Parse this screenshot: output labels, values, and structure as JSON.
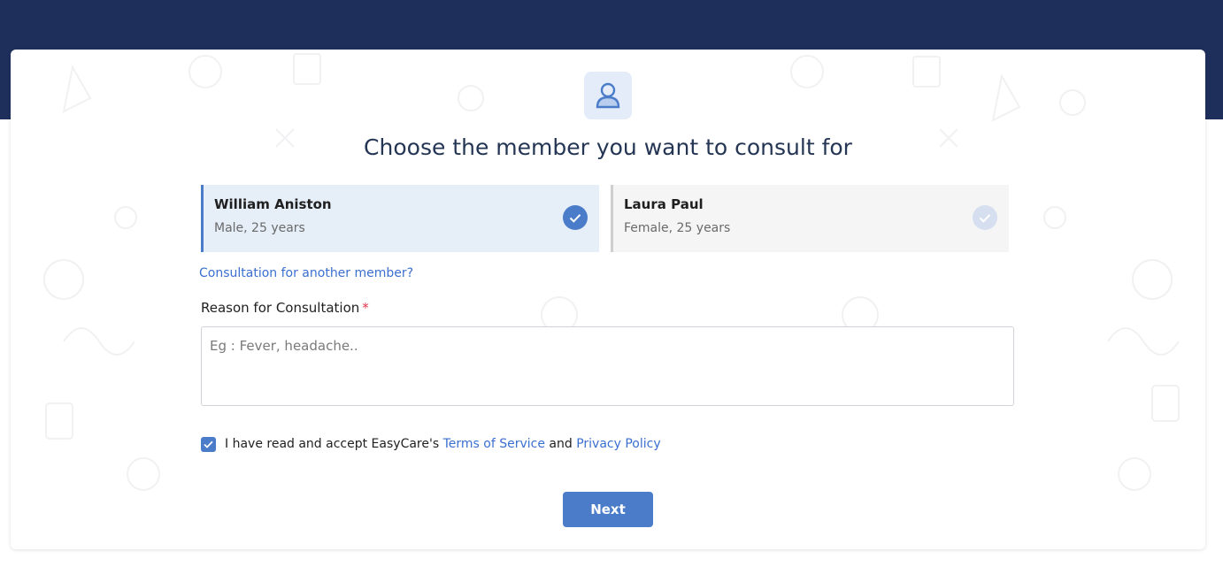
{
  "header": {
    "bar_color": "#1f2f5c"
  },
  "page": {
    "avatar_icon": "user-icon",
    "title": "Choose the member you want to consult for"
  },
  "members": [
    {
      "name": "William Aniston",
      "details": "Male, 25 years",
      "selected": true
    },
    {
      "name": "Laura Paul",
      "details": "Female, 25 years",
      "selected": false
    }
  ],
  "another_member_link": "Consultation for another member?",
  "reason": {
    "label": "Reason for Consultation",
    "required_mark": "*",
    "placeholder": "Eg : Fever, headache..",
    "value": ""
  },
  "terms": {
    "checked": true,
    "prefix": "I have read and accept EasyCare's",
    "terms_link": "Terms of Service",
    "conjunction": "and",
    "privacy_link": "Privacy Policy"
  },
  "next_button": "Next",
  "colors": {
    "accent": "#4a7cc9",
    "link": "#3a6fd0",
    "required": "#e0334a",
    "selected_bg": "#e6eef8"
  }
}
